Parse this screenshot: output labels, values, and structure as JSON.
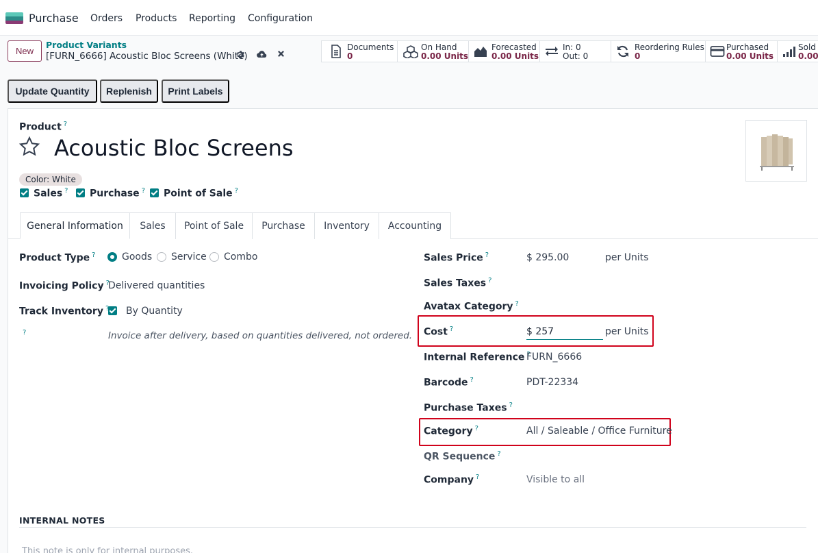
{
  "navbar": {
    "app_name": "Purchase",
    "menu": [
      "Orders",
      "Products",
      "Reporting",
      "Configuration"
    ]
  },
  "control": {
    "new_label": "New",
    "breadcrumb_parent": "Product Variants",
    "breadcrumb_current": "[FURN_6666] Acoustic Bloc Screens (White)"
  },
  "smart_buttons": [
    {
      "label": "Documents",
      "value": "0",
      "icon": "document-icon"
    },
    {
      "label": "On Hand",
      "value": "0.00 Units",
      "icon": "cubes-icon"
    },
    {
      "label": "Forecasted",
      "value": "0.00 Units",
      "icon": "area-chart-icon"
    },
    {
      "label": "In: 0",
      "value": "Out: 0",
      "icon": "exchange-icon"
    },
    {
      "label": "Reordering Rules",
      "value": "0",
      "icon": "refresh-icon"
    },
    {
      "label": "Purchased",
      "value": "0.00 Units",
      "icon": "credit-card-icon"
    },
    {
      "label": "Sold",
      "value": "0.00",
      "icon": "signal-icon"
    }
  ],
  "actions": [
    "Update Quantity",
    "Replenish",
    "Print Labels"
  ],
  "product": {
    "section_label": "Product",
    "name": "Acoustic Bloc Screens",
    "attribute_tag": "Color: White",
    "checkboxes": [
      "Sales",
      "Purchase",
      "Point of Sale"
    ]
  },
  "tabs": [
    "General Information",
    "Sales",
    "Point of Sale",
    "Purchase",
    "Inventory",
    "Accounting"
  ],
  "left_fields": {
    "product_type_label": "Product Type",
    "product_type_options": [
      "Goods",
      "Service",
      "Combo"
    ],
    "invoicing_policy_label": "Invoicing Policy",
    "invoicing_policy_value": "Delivered quantities",
    "track_inventory_label": "Track Inventory",
    "track_inventory_value": "By Quantity",
    "hint": "Invoice after delivery, based on quantities delivered, not ordered."
  },
  "right_fields": {
    "sales_price_label": "Sales Price",
    "sales_price_value": "$ 295.00",
    "sales_price_unit": "per Units",
    "sales_taxes_label": "Sales Taxes",
    "avatax_label": "Avatax Category",
    "cost_label": "Cost",
    "cost_value": "$ 257",
    "cost_unit": "per Units",
    "internal_ref_label": "Internal Reference",
    "internal_ref_value": "FURN_6666",
    "barcode_label": "Barcode",
    "barcode_value": "PDT-22334",
    "purchase_taxes_label": "Purchase Taxes",
    "category_label": "Category",
    "category_value": "All / Saleable / Office Furniture",
    "qr_label": "QR Sequence",
    "company_label": "Company",
    "company_value": "Visible to all"
  },
  "notes": {
    "title": "INTERNAL NOTES",
    "placeholder": "This note is only for internal purposes."
  },
  "colors": {
    "accent": "#017e84",
    "brand": "#7a2648",
    "highlight": "#d0021b"
  }
}
